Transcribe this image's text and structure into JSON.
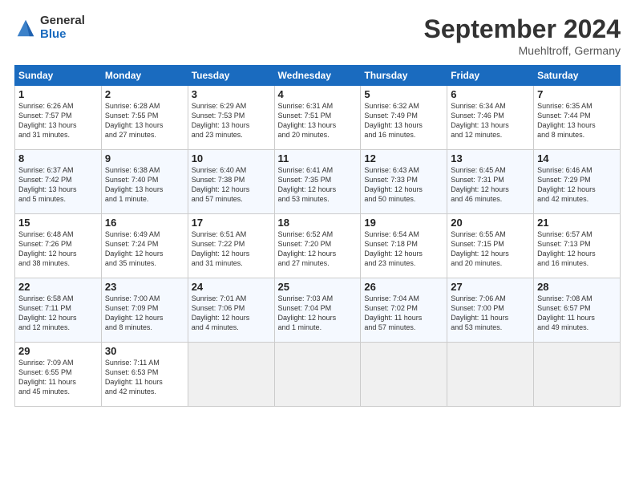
{
  "header": {
    "logo_general": "General",
    "logo_blue": "Blue",
    "month_title": "September 2024",
    "location": "Muehltroff, Germany"
  },
  "days_of_week": [
    "Sunday",
    "Monday",
    "Tuesday",
    "Wednesday",
    "Thursday",
    "Friday",
    "Saturday"
  ],
  "weeks": [
    [
      {
        "day": 1,
        "info": "Sunrise: 6:26 AM\nSunset: 7:57 PM\nDaylight: 13 hours\nand 31 minutes."
      },
      {
        "day": 2,
        "info": "Sunrise: 6:28 AM\nSunset: 7:55 PM\nDaylight: 13 hours\nand 27 minutes."
      },
      {
        "day": 3,
        "info": "Sunrise: 6:29 AM\nSunset: 7:53 PM\nDaylight: 13 hours\nand 23 minutes."
      },
      {
        "day": 4,
        "info": "Sunrise: 6:31 AM\nSunset: 7:51 PM\nDaylight: 13 hours\nand 20 minutes."
      },
      {
        "day": 5,
        "info": "Sunrise: 6:32 AM\nSunset: 7:49 PM\nDaylight: 13 hours\nand 16 minutes."
      },
      {
        "day": 6,
        "info": "Sunrise: 6:34 AM\nSunset: 7:46 PM\nDaylight: 13 hours\nand 12 minutes."
      },
      {
        "day": 7,
        "info": "Sunrise: 6:35 AM\nSunset: 7:44 PM\nDaylight: 13 hours\nand 8 minutes."
      }
    ],
    [
      {
        "day": 8,
        "info": "Sunrise: 6:37 AM\nSunset: 7:42 PM\nDaylight: 13 hours\nand 5 minutes."
      },
      {
        "day": 9,
        "info": "Sunrise: 6:38 AM\nSunset: 7:40 PM\nDaylight: 13 hours\nand 1 minute."
      },
      {
        "day": 10,
        "info": "Sunrise: 6:40 AM\nSunset: 7:38 PM\nDaylight: 12 hours\nand 57 minutes."
      },
      {
        "day": 11,
        "info": "Sunrise: 6:41 AM\nSunset: 7:35 PM\nDaylight: 12 hours\nand 53 minutes."
      },
      {
        "day": 12,
        "info": "Sunrise: 6:43 AM\nSunset: 7:33 PM\nDaylight: 12 hours\nand 50 minutes."
      },
      {
        "day": 13,
        "info": "Sunrise: 6:45 AM\nSunset: 7:31 PM\nDaylight: 12 hours\nand 46 minutes."
      },
      {
        "day": 14,
        "info": "Sunrise: 6:46 AM\nSunset: 7:29 PM\nDaylight: 12 hours\nand 42 minutes."
      }
    ],
    [
      {
        "day": 15,
        "info": "Sunrise: 6:48 AM\nSunset: 7:26 PM\nDaylight: 12 hours\nand 38 minutes."
      },
      {
        "day": 16,
        "info": "Sunrise: 6:49 AM\nSunset: 7:24 PM\nDaylight: 12 hours\nand 35 minutes."
      },
      {
        "day": 17,
        "info": "Sunrise: 6:51 AM\nSunset: 7:22 PM\nDaylight: 12 hours\nand 31 minutes."
      },
      {
        "day": 18,
        "info": "Sunrise: 6:52 AM\nSunset: 7:20 PM\nDaylight: 12 hours\nand 27 minutes."
      },
      {
        "day": 19,
        "info": "Sunrise: 6:54 AM\nSunset: 7:18 PM\nDaylight: 12 hours\nand 23 minutes."
      },
      {
        "day": 20,
        "info": "Sunrise: 6:55 AM\nSunset: 7:15 PM\nDaylight: 12 hours\nand 20 minutes."
      },
      {
        "day": 21,
        "info": "Sunrise: 6:57 AM\nSunset: 7:13 PM\nDaylight: 12 hours\nand 16 minutes."
      }
    ],
    [
      {
        "day": 22,
        "info": "Sunrise: 6:58 AM\nSunset: 7:11 PM\nDaylight: 12 hours\nand 12 minutes."
      },
      {
        "day": 23,
        "info": "Sunrise: 7:00 AM\nSunset: 7:09 PM\nDaylight: 12 hours\nand 8 minutes."
      },
      {
        "day": 24,
        "info": "Sunrise: 7:01 AM\nSunset: 7:06 PM\nDaylight: 12 hours\nand 4 minutes."
      },
      {
        "day": 25,
        "info": "Sunrise: 7:03 AM\nSunset: 7:04 PM\nDaylight: 12 hours\nand 1 minute."
      },
      {
        "day": 26,
        "info": "Sunrise: 7:04 AM\nSunset: 7:02 PM\nDaylight: 11 hours\nand 57 minutes."
      },
      {
        "day": 27,
        "info": "Sunrise: 7:06 AM\nSunset: 7:00 PM\nDaylight: 11 hours\nand 53 minutes."
      },
      {
        "day": 28,
        "info": "Sunrise: 7:08 AM\nSunset: 6:57 PM\nDaylight: 11 hours\nand 49 minutes."
      }
    ],
    [
      {
        "day": 29,
        "info": "Sunrise: 7:09 AM\nSunset: 6:55 PM\nDaylight: 11 hours\nand 45 minutes."
      },
      {
        "day": 30,
        "info": "Sunrise: 7:11 AM\nSunset: 6:53 PM\nDaylight: 11 hours\nand 42 minutes."
      },
      {
        "day": null,
        "info": ""
      },
      {
        "day": null,
        "info": ""
      },
      {
        "day": null,
        "info": ""
      },
      {
        "day": null,
        "info": ""
      },
      {
        "day": null,
        "info": ""
      }
    ]
  ]
}
